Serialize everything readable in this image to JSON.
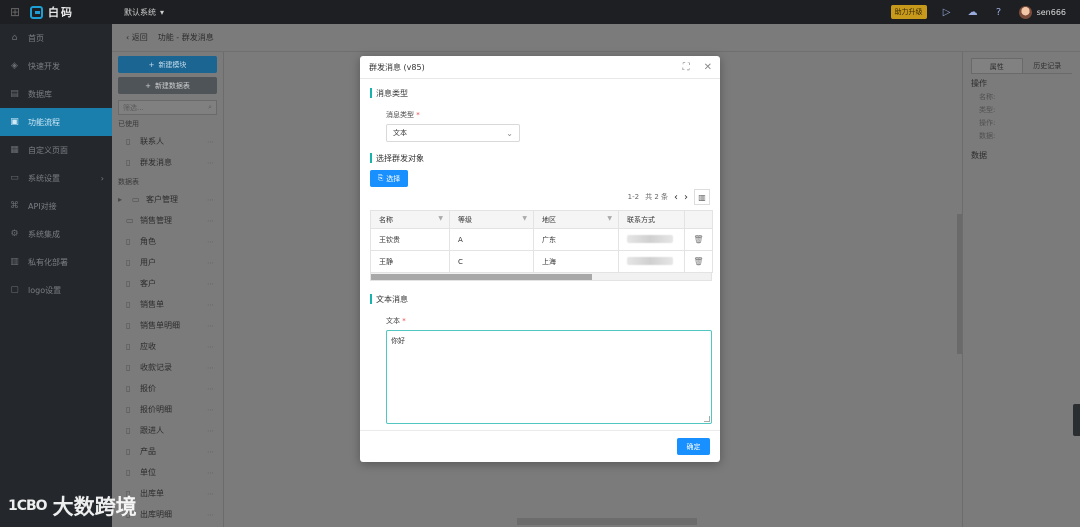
{
  "topbar": {
    "logo_text": "白码",
    "system_select": "默认系统",
    "upgrade_badge": "助力升级",
    "username": "sen666"
  },
  "sidebar": {
    "items": [
      {
        "label": "首页",
        "icon": "home-icon",
        "glyph": "⌂"
      },
      {
        "label": "快速开发",
        "icon": "bolt-icon",
        "glyph": "◈"
      },
      {
        "label": "数据库",
        "icon": "database-icon",
        "glyph": "▤"
      },
      {
        "label": "功能流程",
        "icon": "flow-icon",
        "glyph": "▣"
      },
      {
        "label": "自定义页面",
        "icon": "page-icon",
        "glyph": "▦"
      },
      {
        "label": "系统设置",
        "icon": "settings-icon",
        "glyph": "▭"
      },
      {
        "label": "API对接",
        "icon": "api-icon",
        "glyph": "⌘"
      },
      {
        "label": "系统集成",
        "icon": "integration-icon",
        "glyph": "⚙"
      },
      {
        "label": "私有化部署",
        "icon": "deploy-icon",
        "glyph": "▥"
      },
      {
        "label": "logo设置",
        "icon": "logo-settings-icon",
        "glyph": "▢"
      }
    ]
  },
  "breadcrumb": {
    "back": "返回",
    "path": "功能 - 群发消息"
  },
  "module_panel": {
    "new_module": "新建模块",
    "new_data_table": "新建数据表",
    "search_placeholder": "筛选...",
    "used_label": "已使用",
    "used_items": [
      "联系人",
      "群发消息"
    ],
    "tables_label": "数据表",
    "folder_items": [
      "客户管理",
      "销售管理"
    ],
    "table_items": [
      "角色",
      "用户",
      "客户",
      "销售单",
      "销售单明细",
      "应收",
      "收款记录",
      "报价",
      "报价明细",
      "跟进人",
      "产品",
      "单位",
      "出库单",
      "出库明细"
    ]
  },
  "right_panel": {
    "tabs": [
      "属性",
      "历史记录"
    ],
    "ops_title": "操作",
    "rows": [
      "名称:",
      "类型:",
      "操作:",
      "数据:"
    ],
    "data_title": "数据"
  },
  "modal": {
    "title": "群发消息 (v85)",
    "section_msg_type": "消息类型",
    "msg_type_label": "消息类型",
    "msg_type_value": "文本",
    "section_target": "选择群发对象",
    "pick_button": "选择",
    "pager": {
      "range": "1-2",
      "total": "共 2 条"
    },
    "columns": [
      "名称",
      "等级",
      "地区",
      "联系方式"
    ],
    "rows": [
      {
        "name": "王钦贵",
        "level": "A",
        "region": "广东"
      },
      {
        "name": "王静",
        "level": "C",
        "region": "上海"
      }
    ],
    "section_text": "文本消息",
    "text_label": "文本",
    "text_value": "你好",
    "confirm": "确定"
  },
  "watermark": {
    "mark": "1CBO",
    "text": "大数跨境"
  }
}
